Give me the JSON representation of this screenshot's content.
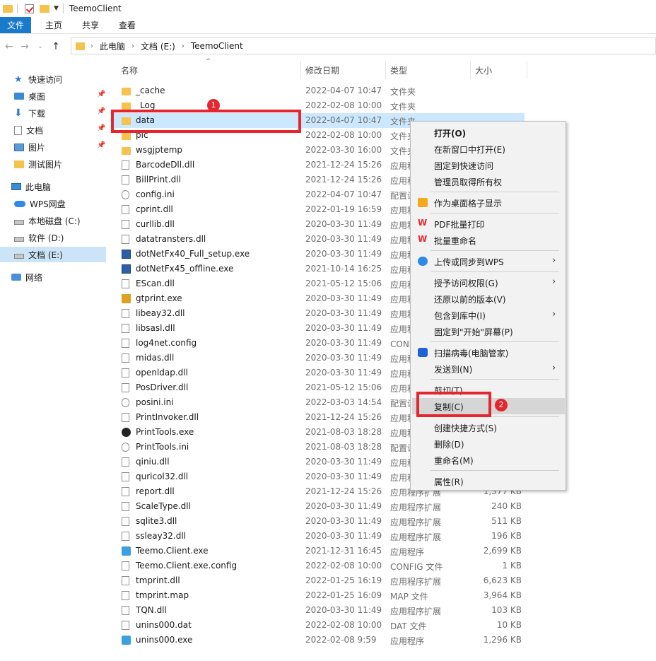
{
  "window": {
    "title": "TeemoClient"
  },
  "ribbon": {
    "tabs": [
      "文件",
      "主页",
      "共享",
      "查看"
    ]
  },
  "address": {
    "crumbs": [
      "此电脑",
      "文档 (E:)",
      "TeemoClient"
    ]
  },
  "sidebar": {
    "items": [
      {
        "label": "快速访问",
        "icon": "star-icon",
        "pinned": false
      },
      {
        "label": "桌面",
        "icon": "desktop-icon",
        "pinned": true
      },
      {
        "label": "下载",
        "icon": "download-icon",
        "pinned": true
      },
      {
        "label": "文档",
        "icon": "document-icon",
        "pinned": true
      },
      {
        "label": "图片",
        "icon": "pictures-icon",
        "pinned": true
      },
      {
        "label": "测试图片",
        "icon": "folder-icon",
        "pinned": false
      },
      {
        "label": "此电脑",
        "icon": "pc-icon",
        "pinned": false
      },
      {
        "label": "WPS网盘",
        "icon": "cloud-icon",
        "pinned": false
      },
      {
        "label": "本地磁盘 (C:)",
        "icon": "drive-icon",
        "pinned": false
      },
      {
        "label": "软件 (D:)",
        "icon": "drive-icon",
        "pinned": false
      },
      {
        "label": "文档 (E:)",
        "icon": "drive-icon",
        "pinned": false,
        "selected": true
      },
      {
        "label": "网络",
        "icon": "network-icon",
        "pinned": false
      }
    ],
    "pin_icon": "📌"
  },
  "columns": {
    "name": "名称",
    "date": "修改日期",
    "type": "类型",
    "size": "大小"
  },
  "files": [
    {
      "name": "_cache",
      "date": "2022-04-07 10:47",
      "type": "文件夹",
      "size": "",
      "icon": "folder"
    },
    {
      "name": "_Log",
      "date": "2022-02-08 10:00",
      "type": "文件夹",
      "size": "",
      "icon": "folder"
    },
    {
      "name": "data",
      "date": "2022-04-07 10:47",
      "type": "文件夹",
      "size": "",
      "icon": "folder",
      "selected": true
    },
    {
      "name": "pic",
      "date": "2022-02-08 10:00",
      "type": "文件夹",
      "size": "",
      "icon": "folder"
    },
    {
      "name": "wsgjptemp",
      "date": "2022-03-30 16:00",
      "type": "文件夹",
      "size": "",
      "icon": "folder"
    },
    {
      "name": "BarcodeDll.dll",
      "date": "2021-12-24 15:26",
      "type": "应用程序扩展",
      "size": "",
      "icon": "file"
    },
    {
      "name": "BillPrint.dll",
      "date": "2021-12-24 15:26",
      "type": "应用程序扩展",
      "size": "",
      "icon": "file"
    },
    {
      "name": "config.ini",
      "date": "2022-04-07 10:47",
      "type": "配置设置",
      "size": "",
      "icon": "gear"
    },
    {
      "name": "cprint.dll",
      "date": "2022-01-19 16:59",
      "type": "应用程序扩展",
      "size": "",
      "icon": "file"
    },
    {
      "name": "curllib.dll",
      "date": "2020-03-30 11:49",
      "type": "应用程序扩展",
      "size": "",
      "icon": "file"
    },
    {
      "name": "datatransters.dll",
      "date": "2020-03-30 11:49",
      "type": "应用程序扩展",
      "size": "",
      "icon": "file"
    },
    {
      "name": "dotNetFx40_Full_setup.exe",
      "date": "2020-03-30 11:49",
      "type": "应用程序",
      "size": "",
      "icon": "exe"
    },
    {
      "name": "dotNetFx45_offline.exe",
      "date": "2021-10-14 16:25",
      "type": "应用程序",
      "size": "",
      "icon": "exe"
    },
    {
      "name": "EScan.dll",
      "date": "2021-05-12 15:06",
      "type": "应用程序扩展",
      "size": "",
      "icon": "file"
    },
    {
      "name": "gtprint.exe",
      "date": "2020-03-30 11:49",
      "type": "应用程序",
      "size": "",
      "icon": "gt"
    },
    {
      "name": "libeay32.dll",
      "date": "2020-03-30 11:49",
      "type": "应用程序扩展",
      "size": "",
      "icon": "file"
    },
    {
      "name": "libsasl.dll",
      "date": "2020-03-30 11:49",
      "type": "应用程序扩展",
      "size": "",
      "icon": "file"
    },
    {
      "name": "log4net.config",
      "date": "2020-03-30 11:49",
      "type": "CONFIG 文件",
      "size": "",
      "icon": "file"
    },
    {
      "name": "midas.dll",
      "date": "2020-03-30 11:49",
      "type": "应用程序扩展",
      "size": "",
      "icon": "file"
    },
    {
      "name": "openldap.dll",
      "date": "2020-03-30 11:49",
      "type": "应用程序扩展",
      "size": "",
      "icon": "file"
    },
    {
      "name": "PosDriver.dll",
      "date": "2021-05-12 15:06",
      "type": "应用程序扩展",
      "size": "",
      "icon": "file"
    },
    {
      "name": "posini.ini",
      "date": "2022-03-03 14:54",
      "type": "配置设置",
      "size": "",
      "icon": "gear"
    },
    {
      "name": "PrintInvoker.dll",
      "date": "2021-12-24 15:26",
      "type": "应用程序扩展",
      "size": "",
      "icon": "file"
    },
    {
      "name": "PrintTools.exe",
      "date": "2021-08-03 18:28",
      "type": "应用程序",
      "size": "",
      "icon": "print"
    },
    {
      "name": "PrintTools.ini",
      "date": "2021-08-03 18:28",
      "type": "配置设置",
      "size": "",
      "icon": "gear"
    },
    {
      "name": "qiniu.dll",
      "date": "2020-03-30 11:49",
      "type": "应用程序扩展",
      "size": "",
      "icon": "file"
    },
    {
      "name": "quricol32.dll",
      "date": "2020-03-30 11:49",
      "type": "应用程序扩展",
      "size": "",
      "icon": "file"
    },
    {
      "name": "report.dll",
      "date": "2021-12-24 15:26",
      "type": "应用程序扩展",
      "size": "1,377 KB",
      "icon": "file"
    },
    {
      "name": "ScaleType.dll",
      "date": "2020-03-30 11:49",
      "type": "应用程序扩展",
      "size": "240 KB",
      "icon": "file"
    },
    {
      "name": "sqlite3.dll",
      "date": "2020-03-30 11:49",
      "type": "应用程序扩展",
      "size": "511 KB",
      "icon": "file"
    },
    {
      "name": "ssleay32.dll",
      "date": "2020-03-30 11:49",
      "type": "应用程序扩展",
      "size": "196 KB",
      "icon": "file"
    },
    {
      "name": "Teemo.Client.exe",
      "date": "2021-12-31 16:45",
      "type": "应用程序",
      "size": "2,699 KB",
      "icon": "app"
    },
    {
      "name": "Teemo.Client.exe.config",
      "date": "2022-02-08 10:00",
      "type": "CONFIG 文件",
      "size": "1 KB",
      "icon": "file"
    },
    {
      "name": "tmprint.dll",
      "date": "2022-01-25 16:19",
      "type": "应用程序扩展",
      "size": "6,623 KB",
      "icon": "file"
    },
    {
      "name": "tmprint.map",
      "date": "2022-01-25 16:09",
      "type": "MAP 文件",
      "size": "3,964 KB",
      "icon": "file"
    },
    {
      "name": "TQN.dll",
      "date": "2020-03-30 11:49",
      "type": "应用程序扩展",
      "size": "103 KB",
      "icon": "file"
    },
    {
      "name": "unins000.dat",
      "date": "2022-02-08 10:00",
      "type": "DAT 文件",
      "size": "10 KB",
      "icon": "file"
    },
    {
      "name": "unins000.exe",
      "date": "2022-02-08 9:59",
      "type": "应用程序",
      "size": "1,296 KB",
      "icon": "app"
    }
  ],
  "context_menu": {
    "items": [
      {
        "label": "打开(O)",
        "bold": true
      },
      {
        "label": "在新窗口中打开(E)"
      },
      {
        "label": "固定到快速访问"
      },
      {
        "label": "管理员取得所有权"
      },
      {
        "sep": true
      },
      {
        "label": "作为桌面格子显示",
        "icon": "grid-icon"
      },
      {
        "sep": true
      },
      {
        "label": "PDF批量打印",
        "icon": "wps-icon"
      },
      {
        "label": "批量重命名",
        "icon": "wps-icon"
      },
      {
        "sep": true
      },
      {
        "label": "上传或同步到WPS",
        "icon": "upload-icon",
        "submenu": true
      },
      {
        "sep": true
      },
      {
        "label": "授予访问权限(G)",
        "submenu": true
      },
      {
        "label": "还原以前的版本(V)"
      },
      {
        "label": "包含到库中(I)",
        "submenu": true
      },
      {
        "label": "固定到\"开始\"屏幕(P)"
      },
      {
        "sep": true
      },
      {
        "label": "扫描病毒(电脑管家)",
        "icon": "shield-icon"
      },
      {
        "label": "发送到(N)",
        "submenu": true
      },
      {
        "sep": true
      },
      {
        "label": "剪切(T)"
      },
      {
        "label": "复制(C)",
        "highlight": true
      },
      {
        "sep": true
      },
      {
        "label": "创建快捷方式(S)"
      },
      {
        "label": "删除(D)"
      },
      {
        "label": "重命名(M)"
      },
      {
        "sep": true
      },
      {
        "label": "属性(R)"
      }
    ],
    "submenu_arrow": "›"
  },
  "annotations": {
    "badge1": "1",
    "badge2": "2",
    "color": "#e5262f"
  },
  "colors": {
    "accent": "#1979ca",
    "selection": "#cce8ff"
  }
}
